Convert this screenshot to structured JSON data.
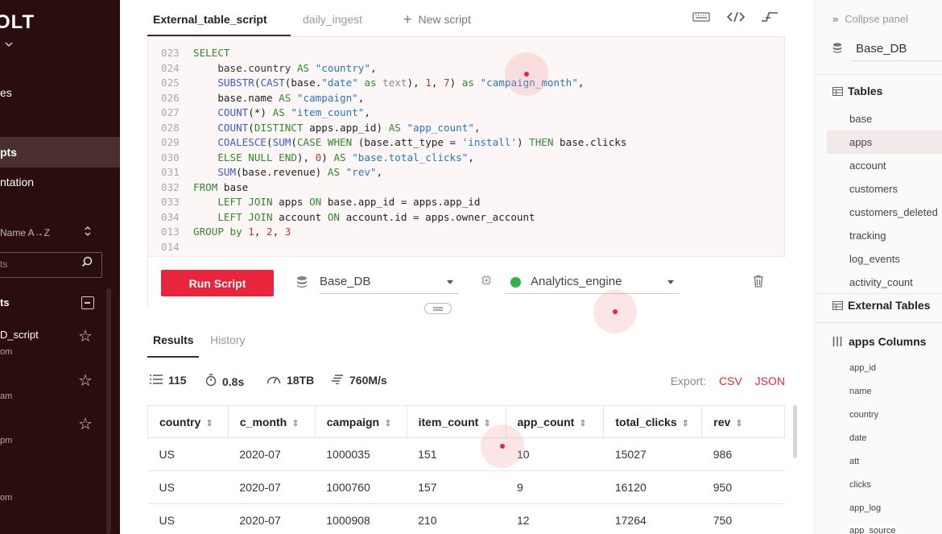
{
  "sidebar": {
    "brand": "OLT",
    "nav": [
      {
        "label": "es"
      },
      {
        "label": "pts"
      },
      {
        "label": "ntation"
      }
    ],
    "sort_label": "Name A→Z",
    "search_placeholder": "ts",
    "section_title": "ts",
    "items": [
      {
        "name": "D_script",
        "sub": "om"
      },
      {
        "name": "",
        "sub": "am"
      },
      {
        "name": "",
        "sub": "pm"
      },
      {
        "name": "",
        "sub": "om"
      }
    ]
  },
  "tabs": {
    "items": [
      "External_table_script",
      "daily_ingest"
    ],
    "new_script": "New script"
  },
  "code": {
    "lines": [
      {
        "n": "023",
        "html": "<span class=\"kw\">SELECT</span>"
      },
      {
        "n": "024",
        "html": "    <span class=\"id\">base.country</span> <span class=\"kw\">AS</span> <span class=\"str\">\"country\"</span>,"
      },
      {
        "n": "025",
        "html": "    <span class=\"fn\">SUBSTR</span>(<span class=\"fn\">CAST</span>(base.<span class=\"str\">\"date\"</span> <span class=\"kw\">as</span> <span class=\"ty\">text</span>), <span class=\"num\">1</span>, <span class=\"num\">7</span>) <span class=\"kw\">as</span> <span class=\"str\">\"campaign_month\"</span>,"
      },
      {
        "n": "026",
        "html": "    base.name <span class=\"kw\">AS</span> <span class=\"str\">\"campaign\"</span>,"
      },
      {
        "n": "027",
        "html": "    <span class=\"fn\">COUNT</span>(*) <span class=\"kw\">AS</span> <span class=\"str\">\"item_count\"</span>,"
      },
      {
        "n": "028",
        "html": "    <span class=\"fn\">COUNT</span>(<span class=\"kw\">DISTINCT</span> apps.app_id) <span class=\"kw\">AS</span> <span class=\"str\">\"app_count\"</span>,"
      },
      {
        "n": "029",
        "html": "    <span class=\"fn\">COALESCE</span>(<span class=\"fn\">SUM</span>(<span class=\"kw\">CASE WHEN</span> (base.att_type = <span class=\"str\">'install'</span>) <span class=\"kw\">THEN</span> base.clicks"
      },
      {
        "n": "030",
        "html": "    <span class=\"kw\">ELSE NULL END</span>), <span class=\"num\">0</span>) <span class=\"kw\">AS</span> <span class=\"str\">\"base.total_clicks\"</span>,"
      },
      {
        "n": "031",
        "html": "    <span class=\"fn\">SUM</span>(base.revenue) <span class=\"kw\">AS</span> <span class=\"str\">\"rev\"</span>,"
      },
      {
        "n": "032",
        "html": "<span class=\"kw\">FROM</span> base"
      },
      {
        "n": "033",
        "html": "    <span class=\"kw\">LEFT JOIN</span> apps <span class=\"kw\">ON</span> base.app_id = apps.app_id"
      },
      {
        "n": "034",
        "html": "    <span class=\"kw\">LEFT JOIN</span> account <span class=\"kw\">ON</span> account.id = apps.owner_account"
      },
      {
        "n": "013",
        "html": "<span class=\"kw\">GROUP by</span> <span class=\"num\">1</span>, <span class=\"num\">2</span>, <span class=\"num\">3</span>"
      },
      {
        "n": "014",
        "html": ""
      }
    ]
  },
  "runbar": {
    "run_label": "Run Script",
    "database": "Base_DB",
    "engine": "Analytics_engine",
    "engine_status_color": "#2fb344"
  },
  "results": {
    "tabs": [
      "Results",
      "History"
    ],
    "stats": {
      "rows": "115",
      "time": "0.8s",
      "scanned": "18TB",
      "speed": "760M/s"
    },
    "export_label": "Export:",
    "export_csv": "CSV",
    "export_json": "JSON",
    "columns": [
      "country",
      "c_month",
      "campaign",
      "item_count",
      "app_count",
      "total_clicks",
      "rev"
    ],
    "rows": [
      [
        "US",
        "2020-07",
        "1000035",
        "151",
        "10",
        "15027",
        "986"
      ],
      [
        "US",
        "2020-07",
        "1000760",
        "157",
        "9",
        "16120",
        "950"
      ],
      [
        "US",
        "2020-07",
        "1000908",
        "210",
        "12",
        "17264",
        "750"
      ]
    ]
  },
  "right": {
    "collapse_label": "Collpse panel",
    "database": "Base_DB",
    "tables_title": "Tables",
    "tables": [
      "base",
      "apps",
      "account",
      "customers",
      "customers_deleted",
      "tracking",
      "log_events",
      "activity_count"
    ],
    "external_title": "External Tables",
    "columns_title": "apps Columns",
    "columns": [
      "app_id",
      "name",
      "country",
      "date",
      "att",
      "clicks",
      "app_log",
      "app_source"
    ]
  },
  "theme": {
    "accent": "#e8253a",
    "sidebar_bg": "#2a0d0d",
    "keyword": "#2e8b2e",
    "function": "#3b5bd6",
    "string": "#2476c7"
  }
}
